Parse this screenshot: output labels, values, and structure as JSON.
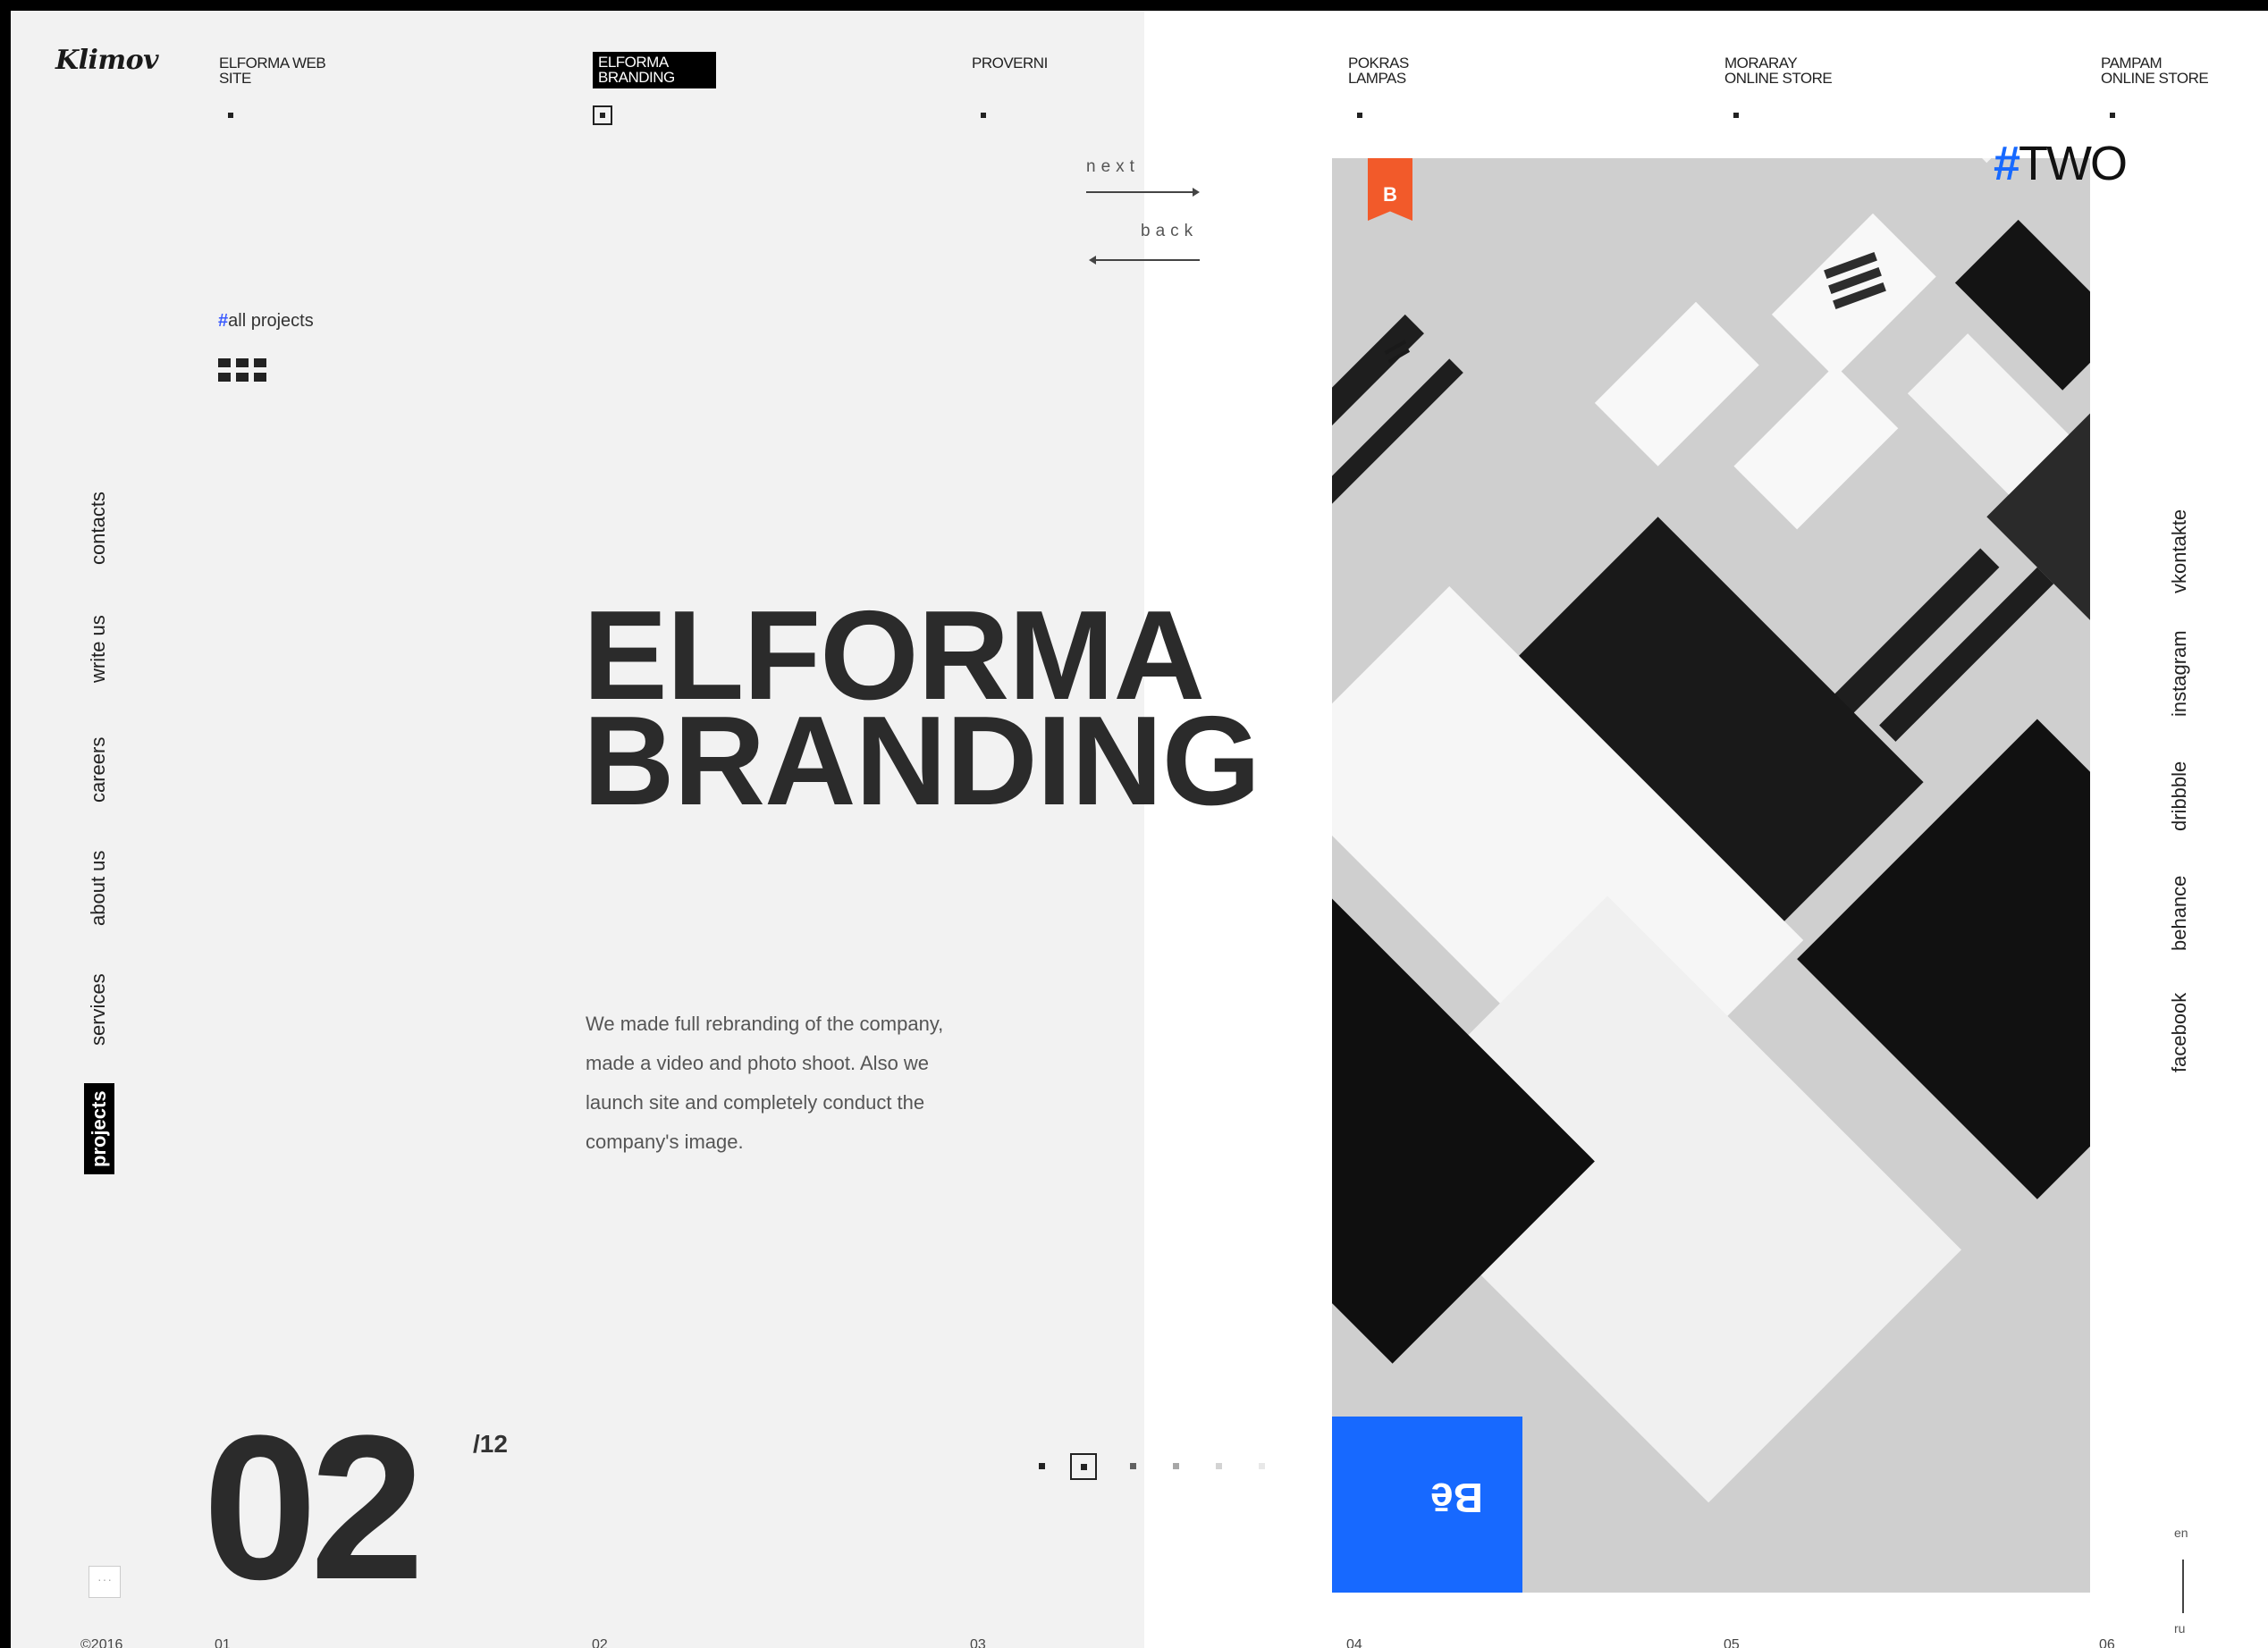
{
  "brand": {
    "logo": "Klimov"
  },
  "top_nav": [
    {
      "label": "ELFORMA WEB\nSITE",
      "active": false
    },
    {
      "label": "ELFORMA\nBRANDING",
      "active": true
    },
    {
      "label": "PROVERNI",
      "active": false
    },
    {
      "label": "POKRAS\nLAMPAS",
      "active": false
    },
    {
      "label": "MORARAY\nONLINE STORE",
      "active": false
    },
    {
      "label": "PAMPAM\nONLINE STORE",
      "active": false
    }
  ],
  "pager_controls": {
    "next": "next",
    "back": "back"
  },
  "all_projects": {
    "hash": "#",
    "label": "all projects"
  },
  "side_nav": [
    {
      "label": "contacts"
    },
    {
      "label": "write us"
    },
    {
      "label": "careers"
    },
    {
      "label": "about us"
    },
    {
      "label": "services"
    },
    {
      "label": "projects",
      "active": true
    }
  ],
  "project": {
    "title_line1": "ELFORMA",
    "title_line2": "BRANDING",
    "description": "We made full rebranding of the company, made a video and photo shoot. Also we launch site and completely conduct the company's image.",
    "number": "02",
    "total": "/12",
    "tag_hash": "#",
    "tag_word": "TWO"
  },
  "badges": {
    "bookmark": "B",
    "behance": "Bē"
  },
  "social": [
    {
      "label": "vkontakte"
    },
    {
      "label": "instagram"
    },
    {
      "label": "dribbble"
    },
    {
      "label": "behance"
    },
    {
      "label": "facebook"
    }
  ],
  "footer": {
    "copyright": "©2016",
    "columns": [
      "01",
      "02",
      "03",
      "04",
      "05",
      "06"
    ]
  },
  "language": {
    "current": "en",
    "other": "ru"
  },
  "colors": {
    "accent_blue": "#1769ff",
    "bookmark_orange": "#f25a2a",
    "text_dark": "#2b2b2b"
  }
}
